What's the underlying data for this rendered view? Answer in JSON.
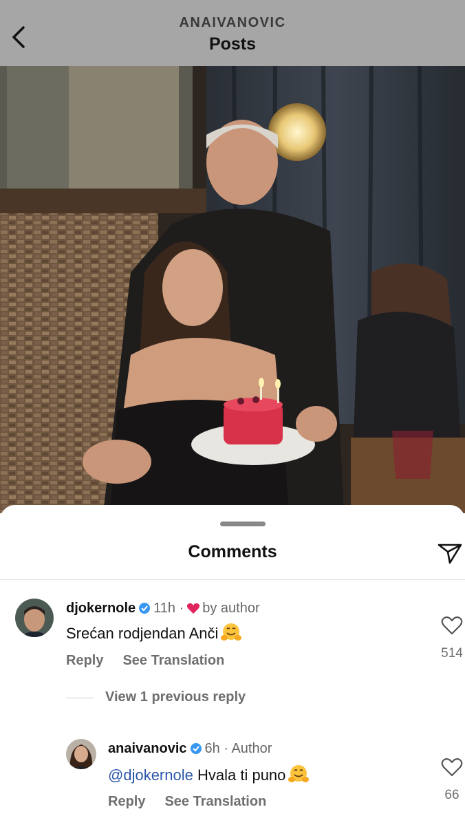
{
  "header": {
    "username": "ANAIVANOVIC",
    "title": "Posts"
  },
  "comments_sheet": {
    "title": "Comments",
    "view_previous": "View 1 previous reply",
    "comments": [
      {
        "username": "djokernole",
        "time": "11h",
        "badge": "by author",
        "text": "Srećan rodjendan Anči",
        "reply_label": "Reply",
        "translate_label": "See Translation",
        "likes": "514"
      },
      {
        "username": "anaivanovic",
        "time": "6h",
        "badge": "Author",
        "mention": "@djokernole",
        "text": "Hvala ti puno",
        "reply_label": "Reply",
        "translate_label": "See Translation",
        "likes": "66"
      }
    ]
  },
  "colors": {
    "header_bg": "#a6a6a6",
    "verified": "#3897f0",
    "heart": "#e0245e",
    "mention": "#2b56a8"
  }
}
